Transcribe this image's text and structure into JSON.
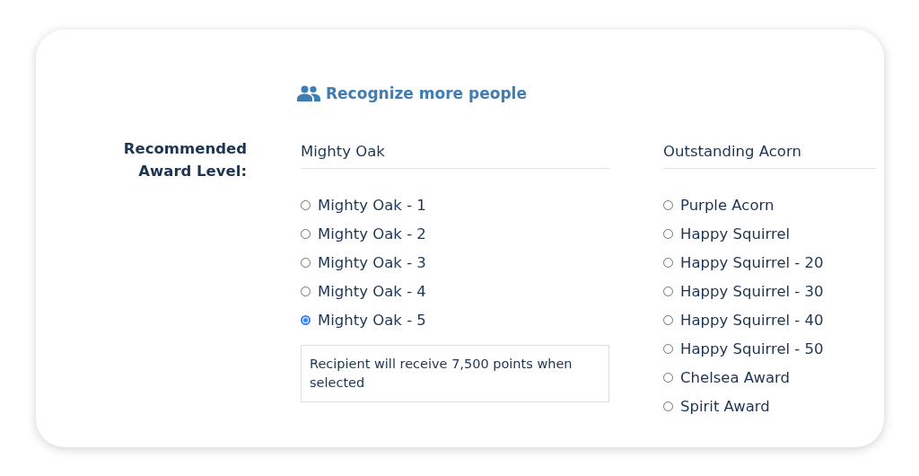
{
  "link": {
    "label": "Recognize more people"
  },
  "field_label": "Recommended Award Level:",
  "groups": [
    {
      "title": "Mighty Oak",
      "options": [
        {
          "label": "Mighty Oak - 1",
          "selected": false
        },
        {
          "label": "Mighty Oak - 2",
          "selected": false
        },
        {
          "label": "Mighty Oak - 3",
          "selected": false
        },
        {
          "label": "Mighty Oak - 4",
          "selected": false
        },
        {
          "label": "Mighty Oak - 5",
          "selected": true
        }
      ],
      "note": "Recipient will receive 7,500 points when selected"
    },
    {
      "title": "Outstanding Acorn",
      "options": [
        {
          "label": "Purple Acorn",
          "selected": false
        },
        {
          "label": "Happy Squirrel",
          "selected": false
        },
        {
          "label": "Happy Squirrel - 20",
          "selected": false
        },
        {
          "label": "Happy Squirrel - 30",
          "selected": false
        },
        {
          "label": "Happy Squirrel - 40",
          "selected": false
        },
        {
          "label": "Happy Squirrel - 50",
          "selected": false
        },
        {
          "label": "Chelsea Award",
          "selected": false
        },
        {
          "label": "Spirit Award",
          "selected": false
        }
      ]
    }
  ]
}
